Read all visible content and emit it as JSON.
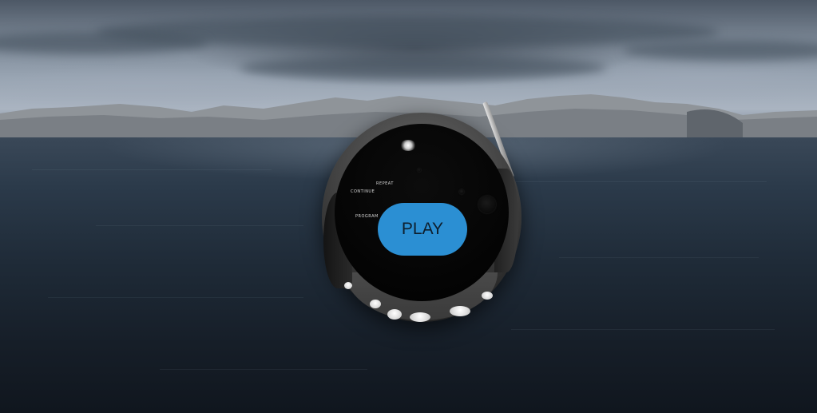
{
  "scene": {
    "sky_color": "#8e9aa8",
    "water_color": "#1f2b38"
  },
  "device": {
    "menu_items": [
      {
        "label": "REPEAT"
      },
      {
        "label": "CONTINUE"
      },
      {
        "label": "PROGRAM"
      }
    ],
    "play_button": {
      "label": "PLAY",
      "color": "#2b8fd3"
    },
    "icons": {
      "highlight": "light-reflection-icon",
      "antenna": "antenna-icon"
    }
  }
}
